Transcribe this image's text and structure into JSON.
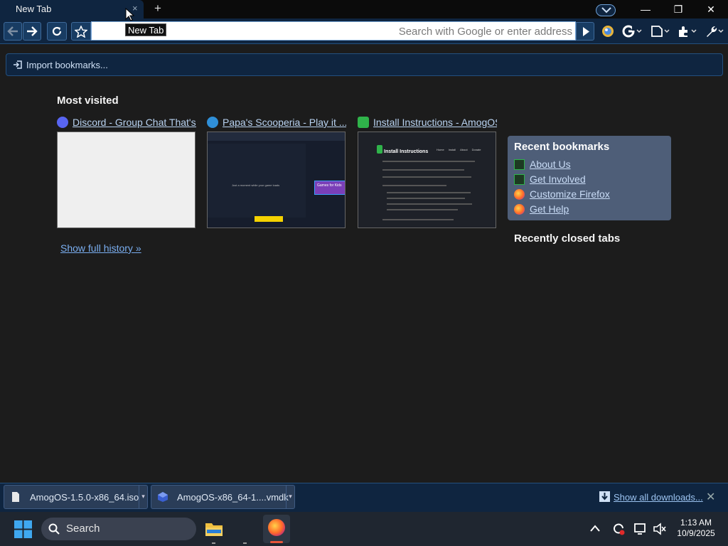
{
  "browser": {
    "tab_title": "New Tab",
    "tab_close": "×",
    "new_tab": "+",
    "tooltip": "New Tab",
    "url_placeholder": "Search with Google or enter address",
    "window_controls": {
      "minimize": "—",
      "maximize": "❐",
      "close": "✕"
    }
  },
  "bookmarks_bar": {
    "import_label": "Import bookmarks..."
  },
  "new_tab_page": {
    "most_visited_heading": "Most visited",
    "sites": [
      {
        "title": "Discord - Group Chat That's ...",
        "icon": "discord-icon",
        "color": "#5865f2"
      },
      {
        "title": "Papa's Scooperia - Play it ...",
        "icon": "game-icon",
        "color": "#2f8fd8"
      },
      {
        "title": "Install Instructions - AmogOS",
        "icon": "amogos-icon",
        "color": "#2fb34a"
      }
    ],
    "thumb_text": {
      "papa_caption": "Just a moment while your game loads",
      "papa_banner": "Games for Kids",
      "install_heading": "Install Instructions",
      "install_nav": [
        "Home",
        "Install",
        "About",
        "Donate"
      ]
    },
    "show_history": "Show full history »",
    "recent_bookmarks_heading": "Recent bookmarks",
    "recent_bookmarks": [
      {
        "label": "About Us",
        "icon": "amogos-icon"
      },
      {
        "label": "Get Involved",
        "icon": "amogos-icon"
      },
      {
        "label": "Customize Firefox",
        "icon": "firefox-icon"
      },
      {
        "label": "Get Help",
        "icon": "firefox-icon"
      }
    ],
    "recently_closed_heading": "Recently closed tabs"
  },
  "downloads": {
    "items": [
      {
        "name": "AmogOS-1.5.0-x86_64.iso",
        "icon": "file-icon"
      },
      {
        "name": "AmogOS-x86_64-1....vmdk",
        "icon": "virtualbox-icon"
      }
    ],
    "show_all": "Show all downloads...",
    "close": "✕"
  },
  "taskbar": {
    "search_label": "Search",
    "time": "1:13 AM",
    "date": "10/9/2025"
  },
  "colors": {
    "accent": "#0f2540",
    "panel": "#4e5e78",
    "link": "#b8d2f0"
  }
}
